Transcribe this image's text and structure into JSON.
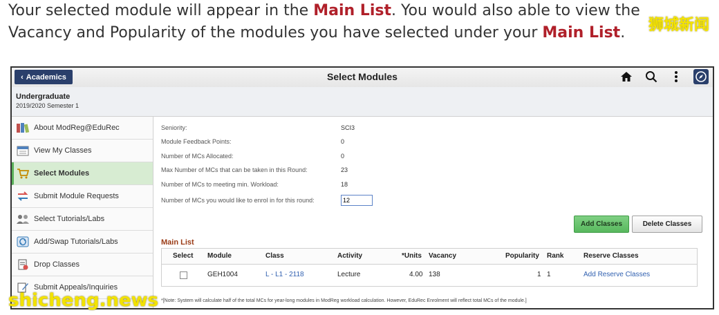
{
  "caption": {
    "part1": "Your selected module will appear in the ",
    "highlight1": "Main List",
    "part2": ". You would also able to view the Vacancy and Popularity of the modules you have selected under your ",
    "highlight2": "Main List",
    "part3": "."
  },
  "watermarks": {
    "top": "狮城新闻",
    "bottom": "shicheng.news"
  },
  "topbar": {
    "back_label": "Academics",
    "title": "Select Modules"
  },
  "subheader": {
    "career": "Undergraduate",
    "term": "2019/2020 Semester 1"
  },
  "sidebar": {
    "items": [
      {
        "label": "About ModReg@EduRec",
        "icon": "book-stack-icon"
      },
      {
        "label": "View My Classes",
        "icon": "calendar-icon"
      },
      {
        "label": "Select Modules",
        "icon": "shopping-cart-icon",
        "active": true
      },
      {
        "label": "Submit Module Requests",
        "icon": "swap-arrows-icon"
      },
      {
        "label": "Select Tutorials/Labs",
        "icon": "people-icon"
      },
      {
        "label": "Add/Swap Tutorials/Labs",
        "icon": "refresh-icon"
      },
      {
        "label": "Drop Classes",
        "icon": "drop-document-icon"
      },
      {
        "label": "Submit Appeals/Inquiries",
        "icon": "edit-note-icon"
      }
    ]
  },
  "info": [
    {
      "label": "Seniority:",
      "value": "SCI3"
    },
    {
      "label": "Module Feedback Points:",
      "value": "0"
    },
    {
      "label": "Number of MCs Allocated:",
      "value": "0"
    },
    {
      "label": "Max Number of MCs that can be taken in this Round:",
      "value": "23"
    },
    {
      "label": "Number of MCs to meeting min. Workload:",
      "value": "18"
    }
  ],
  "enrol": {
    "label": "Number of MCs you would like to enrol in for this round:",
    "value": "12"
  },
  "buttons": {
    "add": "Add Classes",
    "delete": "Delete Classes"
  },
  "main_list": {
    "title": "Main List",
    "columns": [
      "Select",
      "Module",
      "Class",
      "Activity",
      "*Units",
      "Vacancy",
      "Popularity",
      "Rank",
      "Reserve Classes"
    ],
    "rows": [
      {
        "module": "GEH1004",
        "class": "L - L1 - 2118",
        "activity": "Lecture",
        "units": "4.00",
        "vacancy": "138",
        "popularity": "1",
        "rank": "1",
        "reserve": "Add Reserve Classes"
      }
    ]
  },
  "note": "*[Note: System will calculate half of the total MCs for year-long modules in ModReg workload calculation. However, EduRec Enrolment will reflect total MCs of the module.]"
}
